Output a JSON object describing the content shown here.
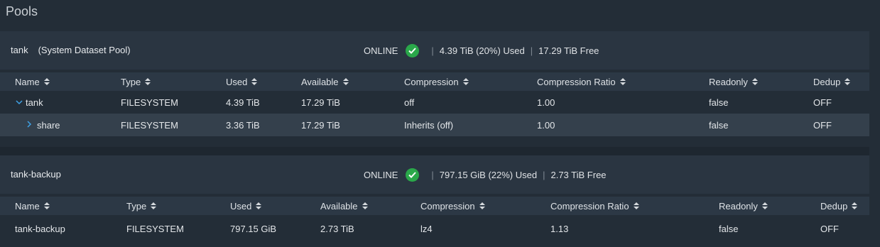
{
  "page": {
    "title": "Pools"
  },
  "colors": {
    "online": "#2aa84a",
    "accent": "#3fa2e6"
  },
  "pools": [
    {
      "name": "tank",
      "subtitle": "(System Dataset Pool)",
      "status": "ONLINE",
      "used": "4.39 TiB (20%) Used",
      "free": "17.29 TiB Free",
      "columns": [
        "Name",
        "Type",
        "Used",
        "Available",
        "Compression",
        "Compression Ratio",
        "Readonly",
        "Dedup"
      ],
      "rows": [
        {
          "expander": "chevron-down",
          "name": "tank",
          "type": "FILESYSTEM",
          "used": "4.39 TiB",
          "available": "17.29 TiB",
          "compression": "off",
          "ratio": "1.00",
          "readonly": "false",
          "dedup": "OFF"
        },
        {
          "expander": "chevron-right",
          "name": "share",
          "type": "FILESYSTEM",
          "used": "3.36 TiB",
          "available": "17.29 TiB",
          "compression": "Inherits (off)",
          "ratio": "1.00",
          "readonly": "false",
          "dedup": "OFF"
        }
      ]
    },
    {
      "name": "tank-backup",
      "subtitle": "",
      "status": "ONLINE",
      "used": "797.15 GiB (22%) Used",
      "free": "2.73 TiB Free",
      "columns": [
        "Name",
        "Type",
        "Used",
        "Available",
        "Compression",
        "Compression Ratio",
        "Readonly",
        "Dedup"
      ],
      "rows": [
        {
          "expander": "",
          "name": "tank-backup",
          "type": "FILESYSTEM",
          "used": "797.15 GiB",
          "available": "2.73 TiB",
          "compression": "lz4",
          "ratio": "1.13",
          "readonly": "false",
          "dedup": "OFF"
        }
      ]
    }
  ]
}
